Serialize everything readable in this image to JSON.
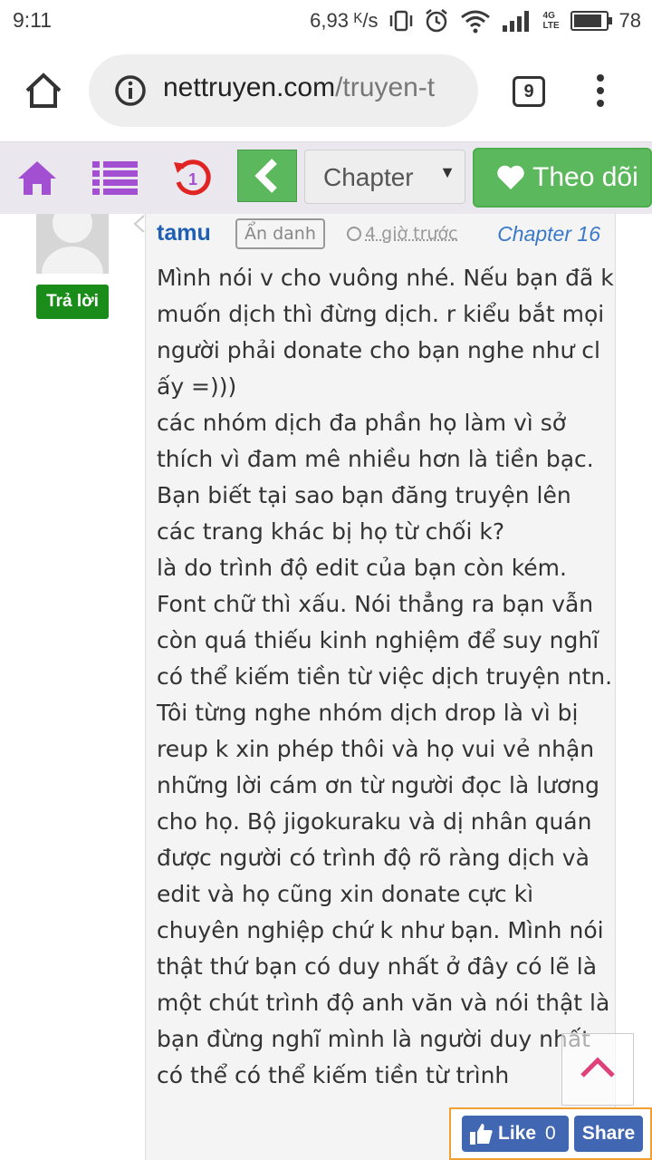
{
  "status_bar": {
    "time": "9:11",
    "speed": "6,93 ᴷ/s",
    "network_type": "4G LTE",
    "battery": "78",
    "battery_level_percent": 78,
    "icons": [
      "vibrate-icon",
      "alarm-icon",
      "wifi-icon",
      "signal-icon",
      "battery-icon"
    ]
  },
  "browser": {
    "url_host": "nettruyen.com",
    "url_path": "/truyen-t",
    "tab_count": "9",
    "icons": [
      "home-icon",
      "info-icon",
      "tabs-icon",
      "more-vert-icon"
    ]
  },
  "site_nav": {
    "chapter_select_label": "Chapter",
    "follow_label": "Theo dõi",
    "history_count": "1",
    "icons": [
      "home-icon",
      "list-icon",
      "history-icon",
      "chevron-left-icon",
      "heart-icon"
    ],
    "colors": {
      "purple": "#a24fd1",
      "red": "#e02424",
      "green": "#5cb85c"
    }
  },
  "comment": {
    "reply_label": "Trả lời",
    "author": "tamu",
    "badge": "Ẩn danh",
    "time": "4 giờ trước",
    "chapter": "Chapter 16",
    "paragraphs": [
      "Mình nói v cho vuông nhé. Nếu bạn đã k muốn dịch thì đừng dịch. r kiểu bắt mọi người phải donate cho bạn nghe như cl ấy =)))",
      "các nhóm dịch đa phần họ làm vì sở thích vì đam mê nhiều hơn là tiền bạc. Bạn biết tại sao bạn đăng truyện lên các trang khác bị họ từ chối k?",
      "là do trình độ edit của bạn còn kém. Font chữ thì xấu. Nói thẳng ra bạn vẫn còn quá thiếu kinh nghiệm để suy nghĩ có thể kiếm tiền từ việc dịch truyện ntn.",
      "Tôi từng nghe nhóm dịch drop là vì bị reup k xin phép thôi và họ vui vẻ nhận những lời cám ơn từ người đọc là lương cho họ. Bộ jigokuraku và dị nhân quán được người có trình độ rõ ràng dịch và edit và họ cũng xin donate cực kì chuyên nghiệp chứ k như bạn. Mình nói thật thứ bạn có duy nhất ở đây có lẽ là một chút trình độ anh văn và nói thật là bạn đừng nghĩ mình là người duy nhất có thể có thể kiếm tiền từ trình"
    ]
  },
  "facebook": {
    "like_label": "Like",
    "like_count": "0",
    "share_label": "Share"
  }
}
